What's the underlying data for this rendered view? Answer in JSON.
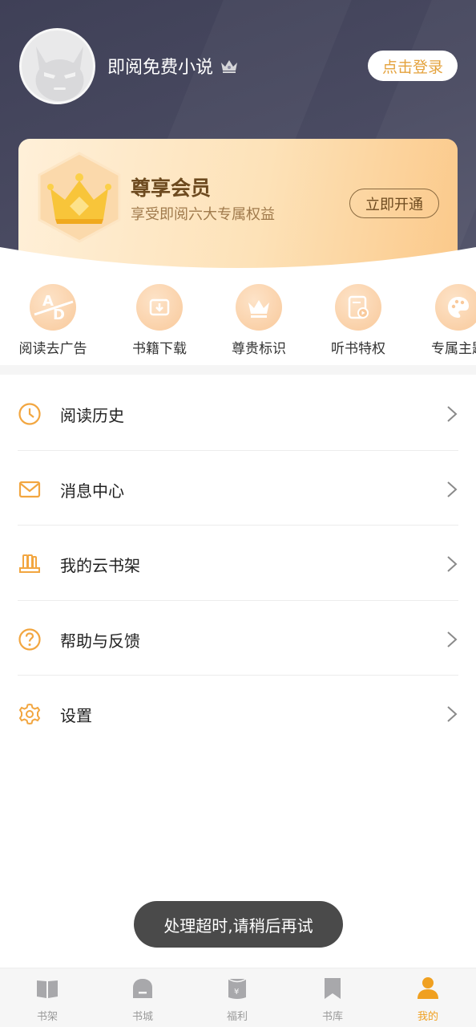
{
  "header": {
    "app_name": "即阅免费小说",
    "login_button": "点击登录"
  },
  "vip": {
    "title": "尊享会员",
    "subtitle": "享受即阅六大专属权益",
    "button": "立即开通"
  },
  "perks": [
    {
      "label": "阅读去广告",
      "icon": "ad-free-icon"
    },
    {
      "label": "书籍下载",
      "icon": "download-icon"
    },
    {
      "label": "尊贵标识",
      "icon": "crown-icon"
    },
    {
      "label": "听书特权",
      "icon": "audiobook-icon"
    },
    {
      "label": "专属主题",
      "icon": "palette-icon"
    }
  ],
  "menu": [
    {
      "label": "阅读历史",
      "icon": "clock-icon"
    },
    {
      "label": "消息中心",
      "icon": "mail-icon"
    },
    {
      "label": "我的云书架",
      "icon": "cloud-shelf-icon"
    },
    {
      "label": "帮助与反馈",
      "icon": "question-icon"
    },
    {
      "label": "设置",
      "icon": "gear-icon"
    }
  ],
  "toast": "处理超时,请稍后再试",
  "tabbar": [
    {
      "label": "书架",
      "icon": "bookshelf-icon",
      "active": false
    },
    {
      "label": "书城",
      "icon": "bookstore-icon",
      "active": false
    },
    {
      "label": "福利",
      "icon": "welfare-icon",
      "active": false
    },
    {
      "label": "书库",
      "icon": "library-bookmark-icon",
      "active": false
    },
    {
      "label": "我的",
      "icon": "profile-icon",
      "active": true
    }
  ],
  "colors": {
    "accent": "#f0a020",
    "header_bg": "#45465c",
    "icon_orange": "#f2a640",
    "toast_bg": "#4a4a4a"
  }
}
